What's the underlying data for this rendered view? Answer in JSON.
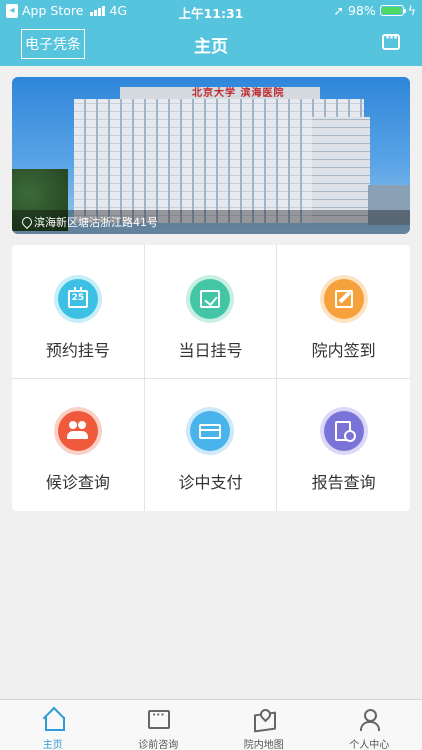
{
  "status_bar": {
    "back_app": "App Store",
    "network": "4G",
    "time": "上午11:31",
    "battery": "98%",
    "battery_level": 0.98
  },
  "header": {
    "left_button": "电子凭条",
    "title": "主页",
    "right_icon": "message-icon"
  },
  "banner": {
    "sign_text": "北京大学 滨海医院",
    "address": "滨海新区塘沽浙江路41号"
  },
  "services": [
    {
      "label": "预约挂号",
      "icon": "calendar-icon",
      "color": "#3cc1e5",
      "ring": "#c8eef8",
      "glyph": "25"
    },
    {
      "label": "当日挂号",
      "icon": "calendar-check-icon",
      "color": "#43c6a6",
      "ring": "#c9efe5",
      "glyph": ""
    },
    {
      "label": "院内签到",
      "icon": "edit-icon",
      "color": "#f5a13c",
      "ring": "#fde3c4",
      "glyph": ""
    },
    {
      "label": "候诊查询",
      "icon": "users-icon",
      "color": "#ef5a3c",
      "ring": "#fbd1c7",
      "glyph": ""
    },
    {
      "label": "诊中支付",
      "icon": "card-icon",
      "color": "#49b3ec",
      "ring": "#cde9fa",
      "glyph": ""
    },
    {
      "label": "报告查询",
      "icon": "report-search-icon",
      "color": "#7b74d8",
      "ring": "#dcd9f6",
      "glyph": ""
    }
  ],
  "tabbar": [
    {
      "label": "主页",
      "icon": "home-icon",
      "active": true
    },
    {
      "label": "诊前咨询",
      "icon": "chat-icon",
      "active": false
    },
    {
      "label": "院内地图",
      "icon": "map-icon",
      "active": false
    },
    {
      "label": "个人中心",
      "icon": "user-icon",
      "active": false
    }
  ]
}
